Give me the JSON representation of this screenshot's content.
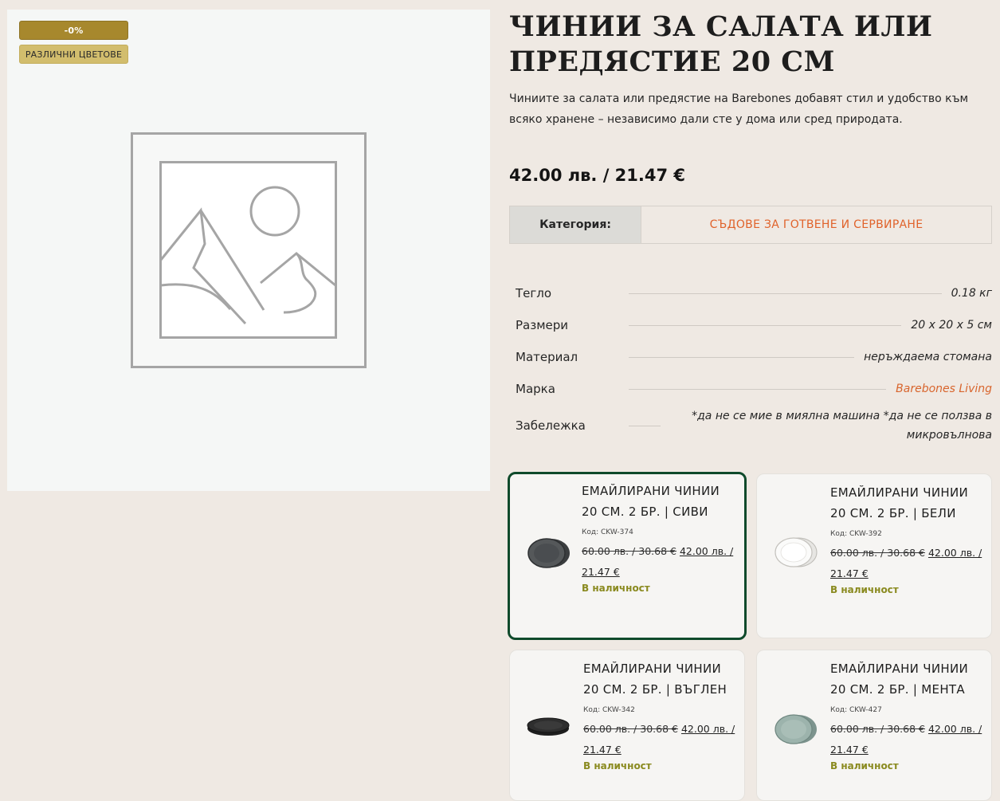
{
  "gallery": {
    "discount_badge": "-0%",
    "colors_badge": "РАЗЛИЧНИ ЦВЕТОВЕ"
  },
  "product": {
    "title": "ЧИНИИ ЗА САЛАТА ИЛИ ПРЕДЯСТИЕ 20 СМ",
    "description": "Чиниите за салата или предястие на Barebones добавят стил и удобство към всяко хранене – независимо дали сте у дома или сред природата.",
    "price": "42.00 лв. / 21.47 €",
    "category_label": "Категория:",
    "category_value": "СЪДОВЕ ЗА ГОТВЕНЕ И СЕРВИРАНЕ"
  },
  "specs": [
    {
      "label": "Тегло",
      "value": "0.18 кг"
    },
    {
      "label": "Размери",
      "value": "20 x 20 x 5 см"
    },
    {
      "label": "Материал",
      "value": "неръждаема стомана"
    },
    {
      "label": "Марка",
      "value": "Barebones Living"
    },
    {
      "label": "Забележка",
      "value": "*да не се мие в миялна машина *да не се ползва в микровълнова"
    }
  ],
  "variants": [
    {
      "title": "ЕМАЙЛИРАНИ ЧИНИИ 20 СМ. 2 БР. | СИВИ",
      "code": "Код: CKW-374",
      "old_price": "60.00 лв. / 30.68 €",
      "new_price": "42.00 лв. / 21.47 €",
      "stock": "В наличност",
      "color": "#4a4d4f"
    },
    {
      "title": "ЕМАЙЛИРАНИ ЧИНИИ 20 СМ. 2 БР. | БЕЛИ",
      "code": "Код: CKW-392",
      "old_price": "60.00 лв. / 30.68 €",
      "new_price": "42.00 лв. / 21.47 €",
      "stock": "В наличност",
      "color": "#f4f4f2"
    },
    {
      "title": "ЕМАЙЛИРАНИ ЧИНИИ 20 СМ. 2 БР. | ВЪГЛЕН",
      "code": "Код: CKW-342",
      "old_price": "60.00 лв. / 30.68 €",
      "new_price": "42.00 лв. / 21.47 €",
      "stock": "В наличност",
      "color": "#2b2b2b"
    },
    {
      "title": "ЕМАЙЛИРАНИ ЧИНИИ 20 СМ. 2 БР. | МЕНТА",
      "code": "Код: CKW-427",
      "old_price": "60.00 лв. / 30.68 €",
      "new_price": "42.00 лв. / 21.47 €",
      "stock": "В наличност",
      "color": "#8fa59f"
    }
  ]
}
